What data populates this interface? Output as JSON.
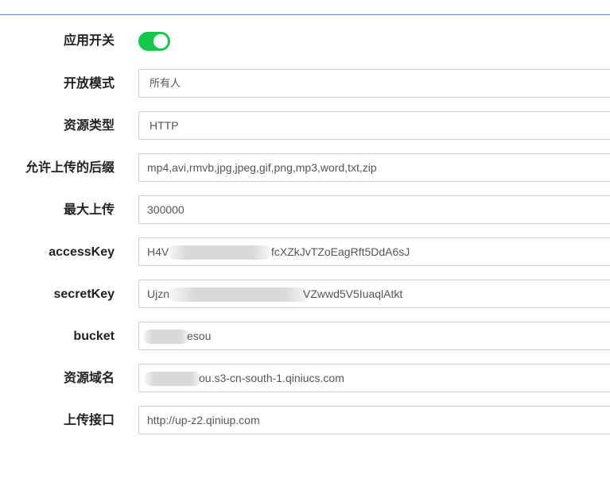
{
  "form": {
    "app_switch": {
      "label": "应用开关",
      "enabled": true,
      "color": "#13c84a"
    },
    "fields": [
      {
        "key": "open_mode",
        "label": "开放模式",
        "value": "所有人"
      },
      {
        "key": "resource_type",
        "label": "资源类型",
        "value": "HTTP"
      },
      {
        "key": "allowed_suffixes",
        "label": "允许上传的后缀",
        "value": "mp4,avi,rmvb,jpg,jpeg,gif,png,mp3,word,txt,zip"
      },
      {
        "key": "max_upload",
        "label": "最大上传",
        "value": "300000"
      },
      {
        "key": "access_key",
        "label": "accessKey",
        "value_prefix": "H4V",
        "value_suffix": "fcXZkJvTZoEagRft5DdA6sJ",
        "redacted": true
      },
      {
        "key": "secret_key",
        "label": "secretKey",
        "value_prefix": "Ujzn",
        "value_suffix": "VZwwd5V5IuaqlAtkt",
        "redacted": true
      },
      {
        "key": "bucket",
        "label": "bucket",
        "value_prefix": "",
        "value_suffix": "esou",
        "redacted": true
      },
      {
        "key": "resource_domain",
        "label": "资源域名",
        "value_prefix": "",
        "value_suffix": "ou.s3-cn-south-1.qiniucs.com",
        "redacted": true
      },
      {
        "key": "upload_endpoint",
        "label": "上传接口",
        "value": "http://up-z2.qiniup.com"
      }
    ]
  },
  "colors": {
    "header_rule": "#4a8ad0",
    "accent_title": "#2f77c8"
  }
}
